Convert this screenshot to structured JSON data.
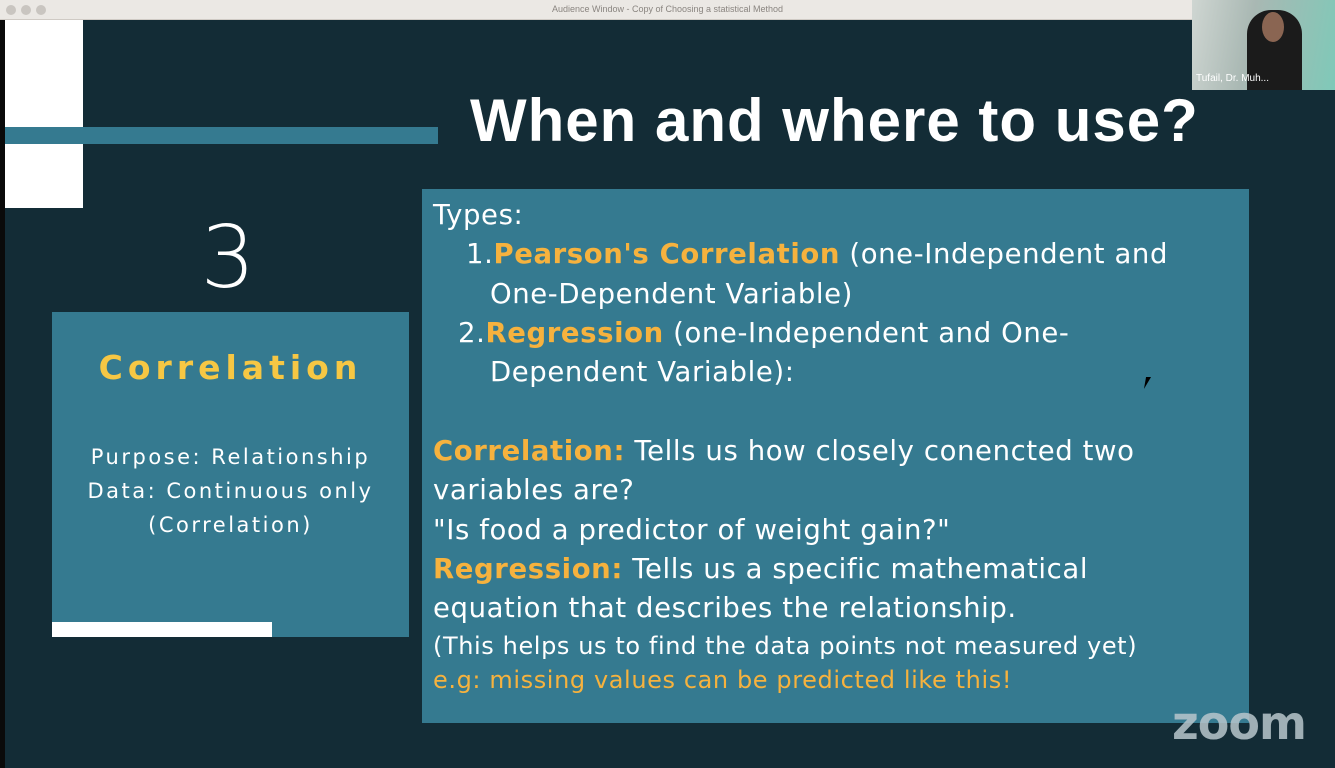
{
  "window": {
    "title": "Audience Window - Copy of Choosing a statistical Method"
  },
  "video": {
    "participant_name": "Tufail, Dr. Muh..."
  },
  "slide": {
    "heading": "When and where to use?",
    "number": "3",
    "left_box": {
      "title": "Correlation",
      "lines": [
        "Purpose: Relationship",
        "Data: Continuous only",
        "(Correlation)"
      ]
    },
    "right_box": {
      "types_label": "Types:",
      "item1": {
        "num": "1.",
        "name": "Pearson's Correlation",
        "desc": " (one-Independent and",
        "desc2": "One-Dependent Variable)"
      },
      "item2": {
        "num": "2.",
        "name": "Regression",
        "desc": " (one-Independent and One-",
        "desc2": "Dependent Variable):"
      },
      "correlation": {
        "label": "Correlation:",
        "text": " Tells us how closely conencted two",
        "text2": "variables are?",
        "quote": "\"Is food a predictor of weight gain?\""
      },
      "regression": {
        "label": "Regression:",
        "text": " Tells us a specific mathematical",
        "text2": "equation that describes the relationship.",
        "note": "(This helps us to find the data points not measured yet)",
        "example": "e.g: missing values can be predicted like this!"
      }
    }
  },
  "brand": {
    "logo": "zoom"
  }
}
